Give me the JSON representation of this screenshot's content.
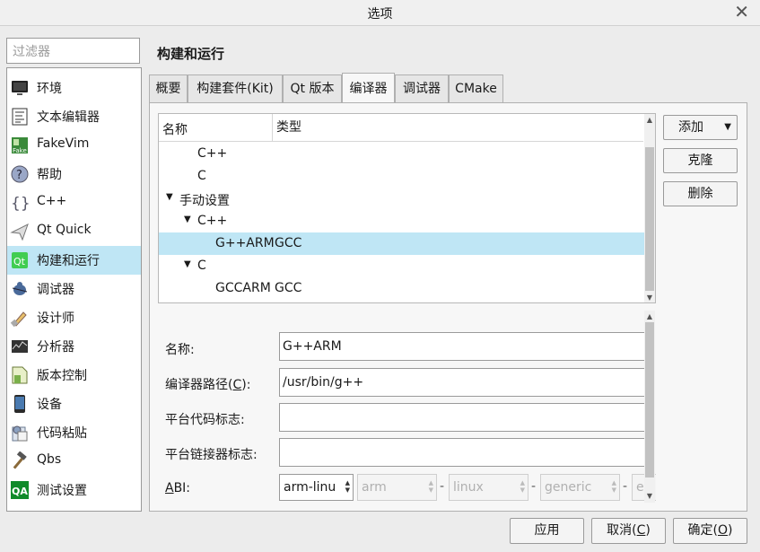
{
  "window": {
    "title": "选项"
  },
  "filter": {
    "placeholder": "过滤器"
  },
  "sidebar": {
    "items": [
      {
        "label": "环境",
        "icon": "monitor-icon"
      },
      {
        "label": "文本编辑器",
        "icon": "text-editor-icon"
      },
      {
        "label": "FakeVim",
        "icon": "fakevim-icon"
      },
      {
        "label": "帮助",
        "icon": "help-icon"
      },
      {
        "label": "C++",
        "icon": "braces-icon"
      },
      {
        "label": "Qt Quick",
        "icon": "qt-quick-icon"
      },
      {
        "label": "构建和运行",
        "icon": "build-run-icon",
        "selected": true
      },
      {
        "label": "调试器",
        "icon": "debugger-icon"
      },
      {
        "label": "设计师",
        "icon": "designer-icon"
      },
      {
        "label": "分析器",
        "icon": "analyzer-icon"
      },
      {
        "label": "版本控制",
        "icon": "version-control-icon"
      },
      {
        "label": "设备",
        "icon": "device-icon"
      },
      {
        "label": "代码粘贴",
        "icon": "code-paste-icon"
      },
      {
        "label": "Qbs",
        "icon": "hammer-icon"
      },
      {
        "label": "测试设置",
        "icon": "qa-icon"
      }
    ]
  },
  "page": {
    "title": "构建和运行"
  },
  "tabs": [
    {
      "label": "概要"
    },
    {
      "label": "构建套件(Kit)"
    },
    {
      "label": "Qt 版本"
    },
    {
      "label": "编译器",
      "active": true
    },
    {
      "label": "调试器"
    },
    {
      "label": "CMake"
    }
  ],
  "tree": {
    "headers": {
      "name": "名称",
      "type": "类型"
    },
    "rows": [
      {
        "name": "C++",
        "type": "",
        "level": 2,
        "arrow": ""
      },
      {
        "name": "C",
        "type": "",
        "level": 2,
        "arrow": ""
      },
      {
        "name": "手动设置",
        "type": "",
        "level": 0,
        "arrow": "▼"
      },
      {
        "name": "C++",
        "type": "",
        "level": 1,
        "arrow": "▼"
      },
      {
        "name": "G++ARM",
        "type": "GCC",
        "level": 2,
        "arrow": "",
        "selected": true
      },
      {
        "name": "C",
        "type": "",
        "level": 1,
        "arrow": "▼"
      },
      {
        "name": "GCCARM",
        "type": "GCC",
        "level": 2,
        "arrow": ""
      }
    ]
  },
  "buttons": {
    "add": "添加",
    "clone": "克隆",
    "remove": "删除"
  },
  "details": {
    "name_label": "名称:",
    "name_value": "G++ARM",
    "path_label_pre": "编译器路径(",
    "path_label_key": "C",
    "path_label_post": "):",
    "path_value": "/usr/bin/g++",
    "platform_code_label": "平台代码标志:",
    "platform_code_value": "",
    "platform_link_label": "平台链接器标志:",
    "platform_link_value": "",
    "abi_label_key": "A",
    "abi_label_rest": "BI:",
    "abi": [
      "arm-linu",
      "arm",
      "linux",
      "generic",
      "e"
    ],
    "separator": "-"
  },
  "footer": {
    "apply": "应用",
    "cancel_pre": "取消(",
    "cancel_key": "C",
    "cancel_post": ")",
    "ok_pre": "确定(",
    "ok_key": "O",
    "ok_post": ")"
  },
  "colors": {
    "selection": "#bfe6f5",
    "background": "#ececec"
  }
}
